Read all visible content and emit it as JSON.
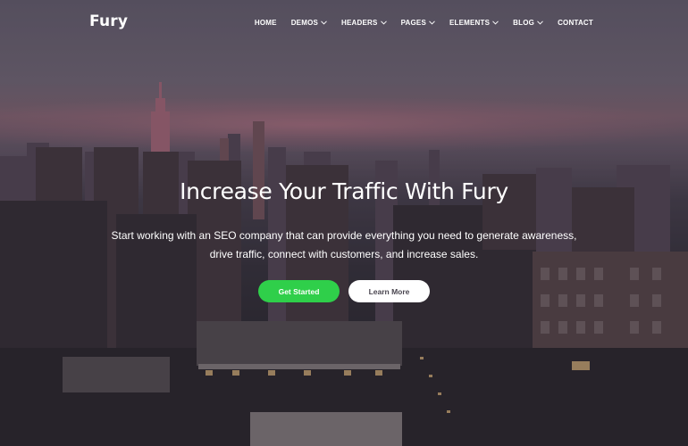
{
  "brand": {
    "logo": "Fury"
  },
  "nav": {
    "items": [
      {
        "label": "HOME",
        "dropdown": false
      },
      {
        "label": "DEMOS",
        "dropdown": true
      },
      {
        "label": "HEADERS",
        "dropdown": true
      },
      {
        "label": "PAGES",
        "dropdown": true
      },
      {
        "label": "ELEMENTS",
        "dropdown": true
      },
      {
        "label": "BLOG",
        "dropdown": true
      },
      {
        "label": "CONTACT",
        "dropdown": false
      }
    ]
  },
  "hero": {
    "headline": "Increase Your Traffic With Fury",
    "subtext": "Start working with an SEO company that can provide everything you need to generate awareness, drive traffic, connect with customers, and increase sales.",
    "primary_button": "Get Started",
    "secondary_button": "Learn More"
  },
  "colors": {
    "accent": "#2fcf4a",
    "text": "#ffffff",
    "secondary_button_bg": "#ffffff"
  },
  "icons": {
    "dropdown": "chevron-down-icon"
  }
}
